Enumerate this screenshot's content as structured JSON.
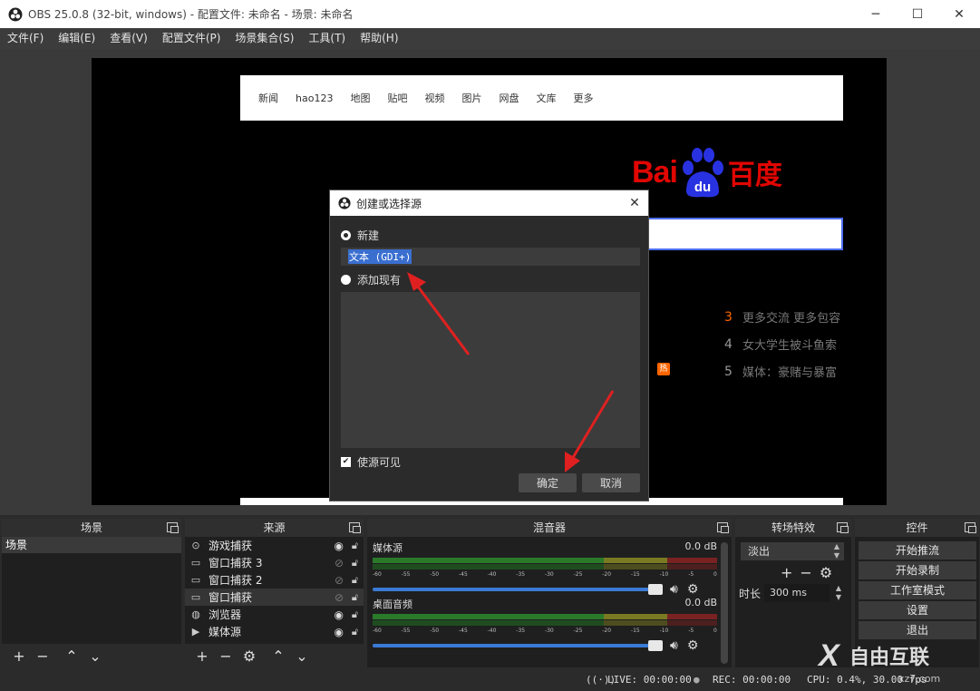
{
  "window": {
    "title": "OBS 25.0.8 (32-bit, windows) - 配置文件: 未命名 - 场景: 未命名",
    "minimize": "─",
    "maximize": "☐",
    "close": "✕"
  },
  "menu": [
    "文件(F)",
    "编辑(E)",
    "查看(V)",
    "配置文件(P)",
    "场景集合(S)",
    "工具(T)",
    "帮助(H)"
  ],
  "preview": {
    "nav_links": [
      "新闻",
      "hao123",
      "地图",
      "贴吧",
      "视频",
      "图片",
      "网盘",
      "文库",
      "更多"
    ],
    "logo_left": "Bai",
    "logo_paw": "du",
    "logo_right": "百度",
    "hot_items": [
      {
        "num": "3",
        "text": "更多交流 更多包容"
      },
      {
        "num": "4",
        "text": "女大学生被斗鱼索"
      },
      {
        "num": "5",
        "text": "媒体：豪赌与暴富"
      }
    ],
    "hot_tag": "热"
  },
  "dialog": {
    "title": "创建或选择源",
    "close": "✕",
    "new_label": "新建",
    "name_value": "文本 (GDI+)",
    "existing_label": "添加现有",
    "visible_label": "使源可见",
    "ok": "确定",
    "cancel": "取消"
  },
  "docks": {
    "scenes": {
      "title": "场景",
      "items": [
        "场景"
      ]
    },
    "sources": {
      "title": "来源",
      "items": [
        {
          "icon": "gamepad-icon",
          "glyph": "⊙",
          "label": "游戏捕获",
          "visible": true
        },
        {
          "icon": "window-icon",
          "glyph": "▭",
          "label": "窗口捕获 3",
          "visible": false
        },
        {
          "icon": "window-icon",
          "glyph": "▭",
          "label": "窗口捕获 2",
          "visible": false
        },
        {
          "icon": "window-icon",
          "glyph": "▭",
          "label": "窗口捕获",
          "visible": false
        },
        {
          "icon": "globe-icon",
          "glyph": "◍",
          "label": "浏览器",
          "visible": true
        },
        {
          "icon": "play-icon",
          "glyph": "▶",
          "label": "媒体源",
          "visible": true
        }
      ]
    },
    "mixer": {
      "title": "混音器",
      "channels": [
        {
          "name": "媒体源",
          "db": "0.0 dB"
        },
        {
          "name": "桌面音频",
          "db": "0.0 dB"
        }
      ],
      "ticks": [
        "-60",
        "-55",
        "-50",
        "-45",
        "-40",
        "-35",
        "-30",
        "-25",
        "-20",
        "-15",
        "-10",
        "-5",
        "0"
      ]
    },
    "transitions": {
      "title": "转场特效",
      "selected": "淡出",
      "duration_label": "时长",
      "duration_value": "300 ms"
    },
    "controls": {
      "title": "控件",
      "buttons": [
        "开始推流",
        "开始录制",
        "工作室模式",
        "设置",
        "退出"
      ]
    }
  },
  "status": {
    "live": "LIVE: 00:00:00",
    "rec": "REC: 00:00:00",
    "cpu": "CPU: 0.4%, 30.00 fps"
  },
  "watermark": {
    "text": "自由互联",
    "url": "xz7.com"
  },
  "colors": {
    "accent": "#3a7bd5",
    "arrow": "#e02020",
    "baidu_red": "#e10601",
    "baidu_blue": "#2932e1"
  }
}
